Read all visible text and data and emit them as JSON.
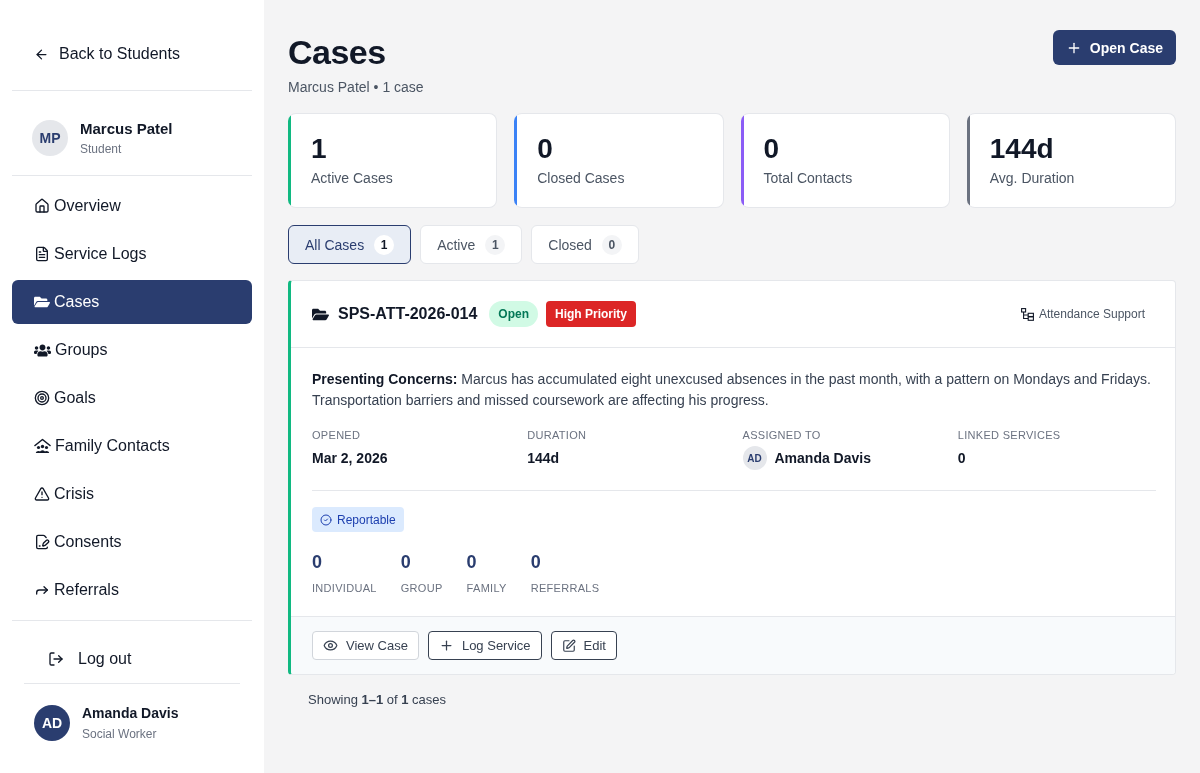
{
  "sidebar": {
    "back_link": {
      "label": "Back to Students"
    },
    "student": {
      "initials": "MP",
      "name": "Marcus Patel",
      "role": "Student"
    },
    "nav": [
      {
        "label": "Overview",
        "selected": false
      },
      {
        "label": "Service Logs",
        "selected": false
      },
      {
        "label": "Cases",
        "selected": true
      },
      {
        "label": "Groups",
        "selected": false
      },
      {
        "label": "Goals",
        "selected": false
      },
      {
        "label": "Family Contacts",
        "selected": false
      },
      {
        "label": "Crisis",
        "selected": false
      },
      {
        "label": "Consents",
        "selected": false
      },
      {
        "label": "Referrals",
        "selected": false
      }
    ],
    "logout": {
      "label": "Log out"
    },
    "user": {
      "initials": "AD",
      "name": "Amanda Davis",
      "role": "Social Worker"
    }
  },
  "header": {
    "title": "Cases",
    "subtitle": "Marcus Patel • 1 case",
    "action": {
      "label": "Open Case"
    }
  },
  "stats": [
    {
      "value": "1",
      "label": "Active Cases",
      "color": "#10b981"
    },
    {
      "value": "0",
      "label": "Closed Cases",
      "color": "#3b82f6"
    },
    {
      "value": "0",
      "label": "Total Contacts",
      "color": "#8b5cf6"
    },
    {
      "value": "144d",
      "label": "Avg. Duration",
      "color": "#6b7280"
    }
  ],
  "tabs": [
    {
      "label": "All Cases",
      "count": "1",
      "selected": true
    },
    {
      "label": "Active",
      "count": "1",
      "selected": false
    },
    {
      "label": "Closed",
      "count": "0",
      "selected": false
    }
  ],
  "cases": [
    {
      "id": "SPS-ATT-2026-014",
      "badges": [
        {
          "kind": "status",
          "label": "Open"
        },
        {
          "kind": "priority",
          "label": "High Priority"
        }
      ],
      "category": "Attendance Support",
      "concerns": "**Presenting Concerns:** Marcus has accumulated eight unexcused absences in the past month, with a pattern on Mondays and Fridays. Transportation barriers and missed coursework are affecting his progress.",
      "details": [
        {
          "kind": "text",
          "label": "OPENED",
          "value": "Mar 2, 2026"
        },
        {
          "kind": "text",
          "label": "DURATION",
          "value": "144d"
        },
        {
          "kind": "person",
          "label": "ASSIGNED TO",
          "initials": "AD",
          "value": "Amanda Davis"
        },
        {
          "kind": "text",
          "label": "LINKED SERVICES",
          "value": "0"
        }
      ],
      "reportable": {
        "label": "Reportable"
      },
      "counts": [
        {
          "value": "0",
          "label": "INDIVIDUAL"
        },
        {
          "value": "0",
          "label": "GROUP"
        },
        {
          "value": "0",
          "label": "FAMILY"
        },
        {
          "value": "0",
          "label": "REFERRALS"
        }
      ],
      "actions": [
        {
          "kind": "view",
          "label": "View Case"
        },
        {
          "kind": "log",
          "label": "Log Service"
        },
        {
          "kind": "edit",
          "label": "Edit"
        }
      ]
    }
  ],
  "pagination": {
    "text": "Showing **1–1** of **1** cases"
  }
}
